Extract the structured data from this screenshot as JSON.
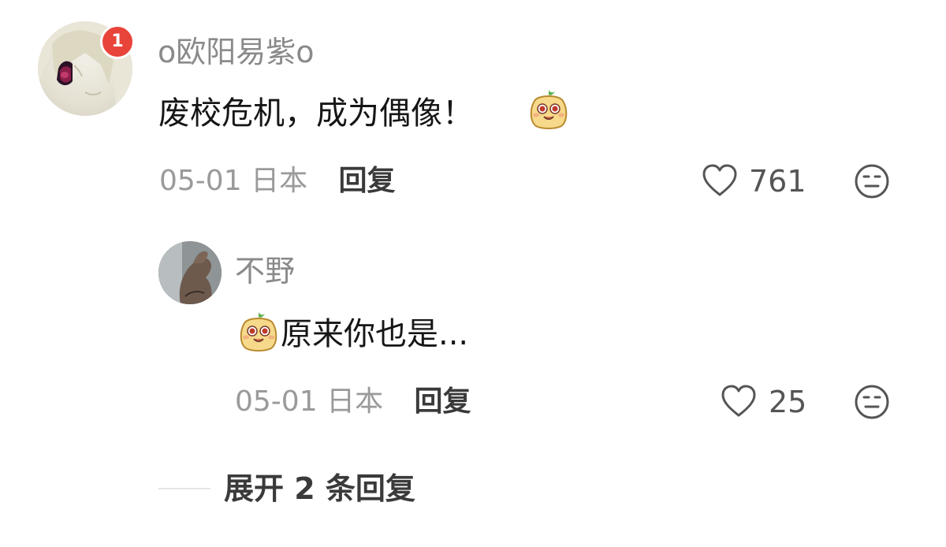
{
  "comment": {
    "username": "o欧阳易紫o",
    "badge": "1",
    "text": "废校危机，成为偶像！",
    "date": "05-01",
    "location": "日本",
    "reply_label": "回复",
    "likes": "761",
    "emoji_icon": "smiling-bun-emoji",
    "avatar_icon": "anime-character-avatar"
  },
  "reply": {
    "username": "不野",
    "text": "原来你也是...",
    "date": "05-01",
    "location": "日本",
    "reply_label": "回复",
    "likes": "25",
    "emoji_icon": "smiling-bun-emoji",
    "avatar_icon": "hand-photo-avatar"
  },
  "expand_label": "展开 2 条回复",
  "colors": {
    "text_primary": "#161616",
    "text_secondary": "#9a9a9a",
    "badge": "#e8443a"
  }
}
